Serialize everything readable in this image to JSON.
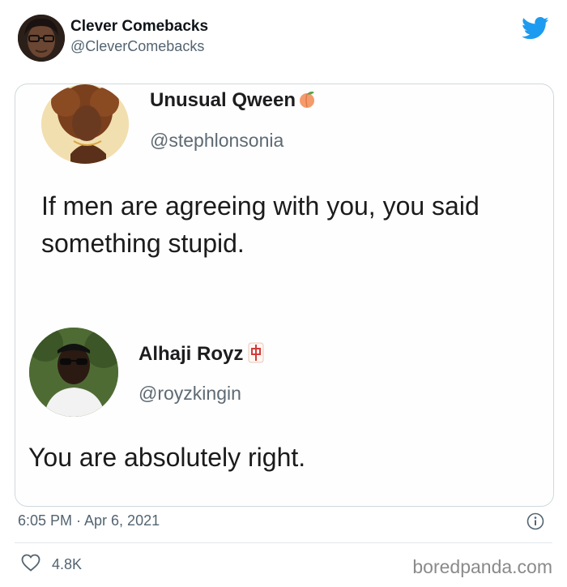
{
  "author": {
    "name": "Clever Comebacks",
    "handle": "@CleverComebacks"
  },
  "icons": {
    "brand": "twitter-bird-icon",
    "info": "info-icon",
    "like": "heart-icon"
  },
  "colors": {
    "twitter_blue": "#1d9bf0",
    "secondary_text": "#536471",
    "card_border": "#cfd9de"
  },
  "embedded": {
    "first": {
      "name": "Unusual Qween",
      "emoji": "peach-emoji",
      "handle": "@stephlonsonia",
      "text_line1": "If men are agreeing with you, you said",
      "text_line2": "something stupid."
    },
    "second": {
      "name": "Alhaji Royz",
      "emoji": "mahjong-red-dragon-emoji",
      "handle": "@royzkingin",
      "text": "You are absolutely right."
    }
  },
  "meta": {
    "timestamp": "6:05 PM · Apr 6, 2021"
  },
  "footer": {
    "likes": "4.8K",
    "watermark": "boredpanda.com"
  }
}
